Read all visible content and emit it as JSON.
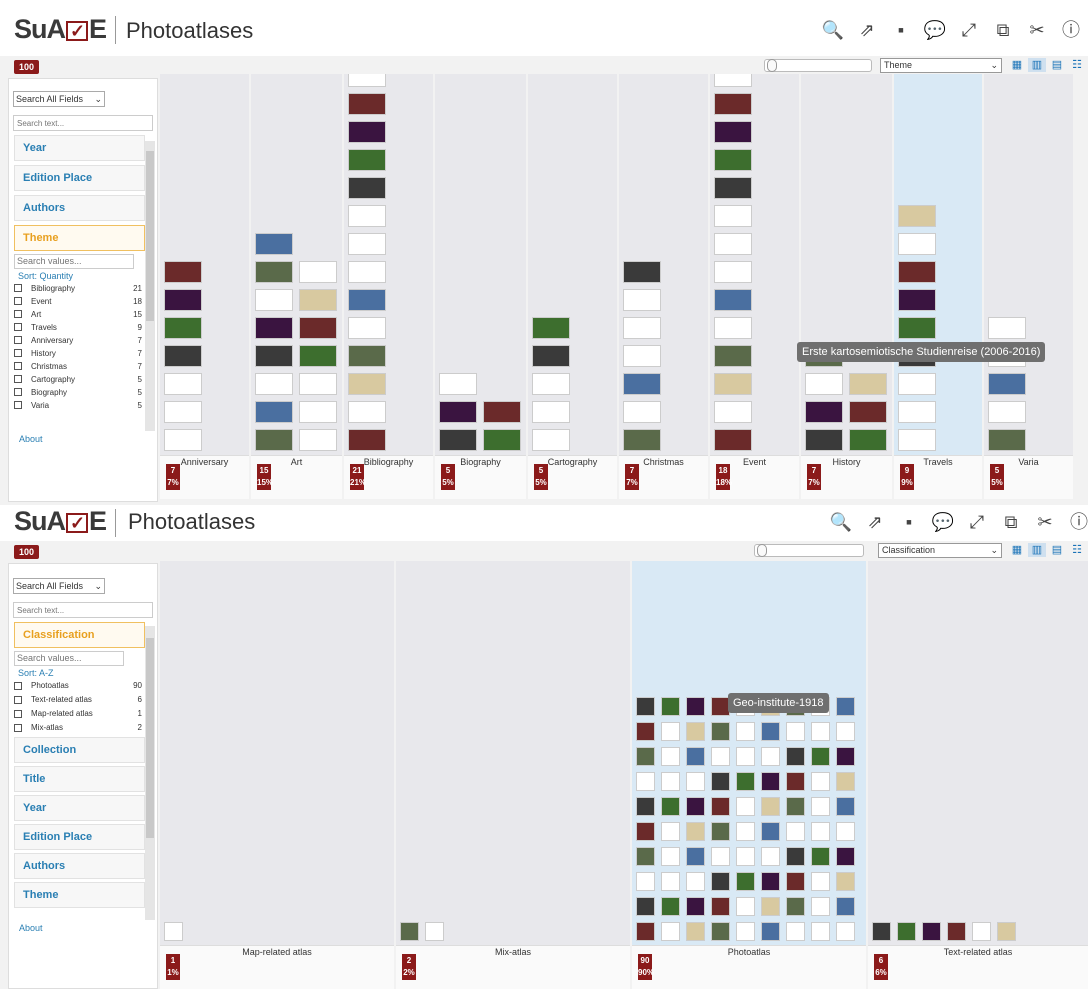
{
  "app": {
    "logo_prefix": "SuA",
    "logo_check": "✓",
    "logo_suffix": "E",
    "title": "Photoatlases"
  },
  "toolbar_icons": [
    "search-icon",
    "share-icon",
    "save-icon",
    "comment-icon",
    "fullscreen-icon",
    "window-icon",
    "tools-icon",
    "info-icon"
  ],
  "toolbar_glyphs": [
    "🔍",
    "⇗",
    "▪",
    "💬",
    "⤢",
    "⧉",
    "✂",
    "ⓘ"
  ],
  "accent": "#8b1a1a",
  "link_color": "#2a7fb3",
  "panel1": {
    "total_badge": "100",
    "group_select": "Theme",
    "search_fields": "Search All Fields",
    "search_placeholder": "Search text...",
    "facets_before": [
      "Year",
      "Edition Place",
      "Authors"
    ],
    "active_facet": "Theme",
    "facet_search_placeholder": "Search values...",
    "sort_label": "Sort: Quantity",
    "values": [
      {
        "name": "Bibliography",
        "count": "21"
      },
      {
        "name": "Event",
        "count": "18"
      },
      {
        "name": "Art",
        "count": "15"
      },
      {
        "name": "Travels",
        "count": "9"
      },
      {
        "name": "Anniversary",
        "count": "7"
      },
      {
        "name": "History",
        "count": "7"
      },
      {
        "name": "Christmas",
        "count": "7"
      },
      {
        "name": "Cartography",
        "count": "5"
      },
      {
        "name": "Biography",
        "count": "5"
      },
      {
        "name": "Varia",
        "count": "5"
      }
    ],
    "about": "About",
    "columns": [
      {
        "name": "Anniversary",
        "count": "7",
        "pct": "7%"
      },
      {
        "name": "Art",
        "count": "15",
        "pct": "15%"
      },
      {
        "name": "Bibliography",
        "count": "21",
        "pct": "21%"
      },
      {
        "name": "Biography",
        "count": "5",
        "pct": "5%"
      },
      {
        "name": "Cartography",
        "count": "5",
        "pct": "5%"
      },
      {
        "name": "Christmas",
        "count": "7",
        "pct": "7%"
      },
      {
        "name": "Event",
        "count": "18",
        "pct": "18%"
      },
      {
        "name": "History",
        "count": "7",
        "pct": "7%"
      },
      {
        "name": "Travels",
        "count": "9",
        "pct": "9%"
      },
      {
        "name": "Varia",
        "count": "5",
        "pct": "5%"
      }
    ],
    "tooltip": "Erste kartosemiotische Studienreise (2006-2016)"
  },
  "panel2": {
    "total_badge": "100",
    "group_select": "Classification",
    "search_fields": "Search All Fields",
    "search_placeholder": "Search text...",
    "active_facet": "Classification",
    "facet_search_placeholder": "Search values...",
    "sort_label": "Sort: A-Z",
    "values": [
      {
        "name": "Photoatlas",
        "count": "90"
      },
      {
        "name": "Text-related atlas",
        "count": "6"
      },
      {
        "name": "Map-related atlas",
        "count": "1"
      },
      {
        "name": "Mix-atlas",
        "count": "2"
      }
    ],
    "facets_after": [
      "Collection",
      "Title",
      "Year",
      "Edition Place",
      "Authors",
      "Theme"
    ],
    "about": "About",
    "columns": [
      {
        "name": "Map-related atlas",
        "count": "1",
        "pct": "1%"
      },
      {
        "name": "Mix-atlas",
        "count": "2",
        "pct": "2%"
      },
      {
        "name": "Photoatlas",
        "count": "90",
        "pct": "90%"
      },
      {
        "name": "Text-related atlas",
        "count": "6",
        "pct": "6%"
      }
    ],
    "tooltip": "Geo-institute-1918"
  }
}
